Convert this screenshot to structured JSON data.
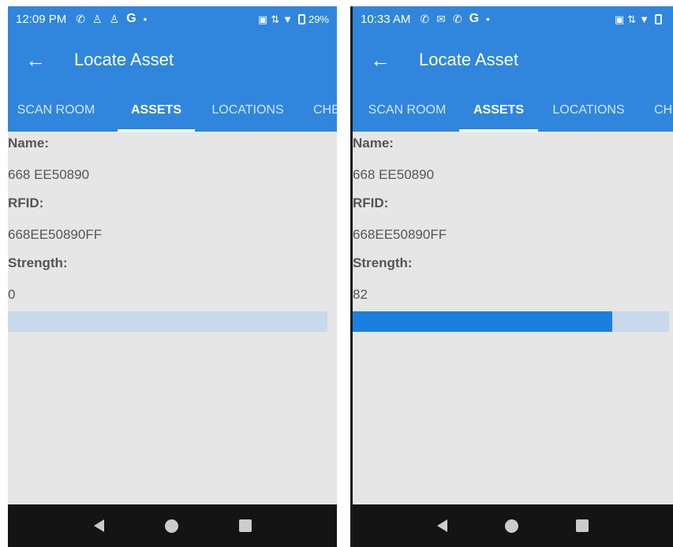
{
  "screens": [
    {
      "status": {
        "time": "12:09 PM",
        "left_icons": [
          "phone-icon",
          "person-icon",
          "person-icon",
          "google-icon",
          "dot-icon"
        ],
        "right_icons": [
          "cast-icon",
          "data-icon",
          "wifi-icon",
          "battery-icon"
        ],
        "battery_text": "29%"
      },
      "appbar": {
        "back_icon": "back-arrow-icon",
        "title": "Locate Asset"
      },
      "tabs": [
        {
          "label": "SCAN ROOM",
          "active": false
        },
        {
          "label": "ASSETS",
          "active": true
        },
        {
          "label": "LOCATIONS",
          "active": false
        },
        {
          "label": "CHE",
          "active": false
        }
      ],
      "fields": {
        "name_label": "Name:",
        "name_value": "668 EE50890",
        "rfid_label": "RFID:",
        "rfid_value": "668EE50890FF",
        "strength_label": "Strength:",
        "strength_value": "0"
      },
      "progress": {
        "value": 0,
        "max": 100
      },
      "nav": [
        "back-triangle-icon",
        "home-circle-icon",
        "recents-square-icon"
      ]
    },
    {
      "status": {
        "time": "10:33 AM",
        "left_icons": [
          "phone-icon",
          "mail-icon",
          "phone-icon",
          "google-icon",
          "dot-icon"
        ],
        "right_icons": [
          "cast-icon",
          "data-icon",
          "wifi-icon",
          "battery-icon"
        ],
        "battery_text": ""
      },
      "appbar": {
        "back_icon": "back-arrow-icon",
        "title": "Locate Asset"
      },
      "tabs": [
        {
          "label": "SCAN ROOM",
          "active": false
        },
        {
          "label": "ASSETS",
          "active": true
        },
        {
          "label": "LOCATIONS",
          "active": false
        },
        {
          "label": "CH",
          "active": false
        }
      ],
      "fields": {
        "name_label": "Name:",
        "name_value": "668 EE50890",
        "rfid_label": "RFID:",
        "rfid_value": "668EE50890FF",
        "strength_label": "Strength:",
        "strength_value": "82"
      },
      "progress": {
        "value": 82,
        "max": 100
      },
      "nav": [
        "back-triangle-icon",
        "home-circle-icon",
        "recents-square-icon"
      ]
    }
  ],
  "colors": {
    "primary": "#2f86dc",
    "background": "#e6e6e6",
    "progress_track": "#c8d9ec",
    "progress_fill": "#1b7fe0",
    "text": "#555555",
    "navbar": "#141414"
  }
}
